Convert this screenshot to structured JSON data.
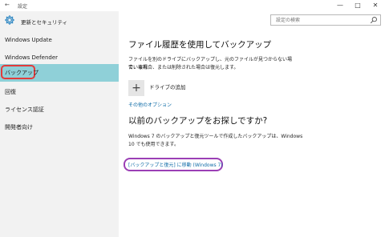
{
  "titlebar": {
    "back_glyph": "←",
    "title": "設定",
    "minimize_glyph": "—",
    "maximize_glyph": "□",
    "close_glyph": "✕"
  },
  "header": {
    "title": "更新とセキュリティ",
    "icon": "gear-icon"
  },
  "search": {
    "placeholder": "設定の検索",
    "icon": "search-icon"
  },
  "sidebar": {
    "items": [
      {
        "label": "Windows Update",
        "selected": false
      },
      {
        "label": "Windows Defender",
        "selected": false
      },
      {
        "label": "バックアップ",
        "selected": true
      },
      {
        "label": "回復",
        "selected": false
      },
      {
        "label": "ライセンス認証",
        "selected": false
      },
      {
        "label": "開発者向け",
        "selected": false
      }
    ]
  },
  "main": {
    "file_history_title": "ファイル履歴を使用してバックアップ",
    "file_history_desc_1": "ファイルを別のドライブにバックアップし、元のファイルが見つからない場合、壊れ",
    "file_history_desc_2": "ている場合、または削除された場合は復元します。",
    "add_drive_glyph": "+",
    "add_drive_label": "ドライブの追加",
    "more_options": "その他のオプション",
    "older_backup_title": "以前のバックアップをお探しですか?",
    "older_backup_desc_1": "Windows 7 のバックアップと復元ツールで作成したバックアップは、Windows",
    "older_backup_desc_2": "10 でも使用できます。",
    "backup_restore_link": "[バックアップと復元] に移動 (Windows 7)"
  },
  "colors": {
    "sidebar_bg": "#f2f2f2",
    "selected_bg": "#8fd0d8",
    "link": "#0f6ca7",
    "annotation_red": "#e23b3b",
    "annotation_purple": "#9b3fb5"
  }
}
